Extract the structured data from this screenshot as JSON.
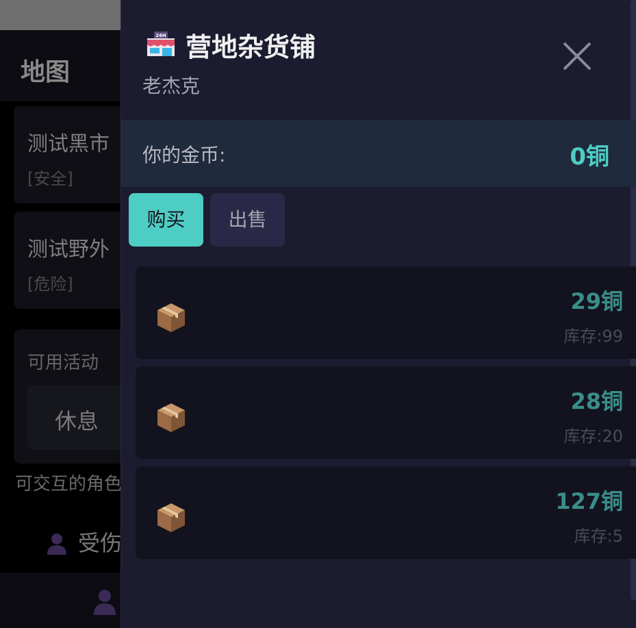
{
  "background": {
    "header_title": "地图",
    "locations": [
      {
        "name": "测试黑市",
        "tag": "[安全]"
      },
      {
        "name": "测试野外",
        "tag": "[危险]"
      }
    ],
    "activities_title": "可用活动",
    "activity_button": "休息",
    "npc_section_title": "可交互的角色",
    "npc_name": "受伤"
  },
  "shop": {
    "title": "营地杂货铺",
    "owner": "老杰克",
    "gold_label": "你的金币:",
    "gold_value": "0铜",
    "tabs": {
      "buy": "购买",
      "sell": "出售"
    },
    "items": [
      {
        "icon": "package-icon",
        "price": "29铜",
        "stock": "库存:99"
      },
      {
        "icon": "package-icon",
        "price": "28铜",
        "stock": "库存:20"
      },
      {
        "icon": "package-icon",
        "price": "127铜",
        "stock": "库存:5"
      }
    ]
  },
  "colors": {
    "accent": "#4ecdc4",
    "panel_bg": "#1c1c30",
    "gold_bar_bg": "#1f2a3d",
    "price": "#3a8e8a"
  }
}
